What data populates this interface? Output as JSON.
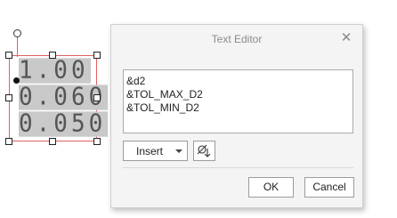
{
  "annotation": {
    "values": [
      "1.00",
      "0.060",
      "0.050"
    ]
  },
  "dialog": {
    "title": "Text Editor",
    "close_icon": "close-icon",
    "text_lines": [
      "&d2",
      "&TOL_MAX_D2",
      "&TOL_MIN_D2"
    ],
    "insert_label": "Insert",
    "symbol_icon": "symbol-insert-icon",
    "ok_label": "OK",
    "cancel_label": "Cancel"
  }
}
